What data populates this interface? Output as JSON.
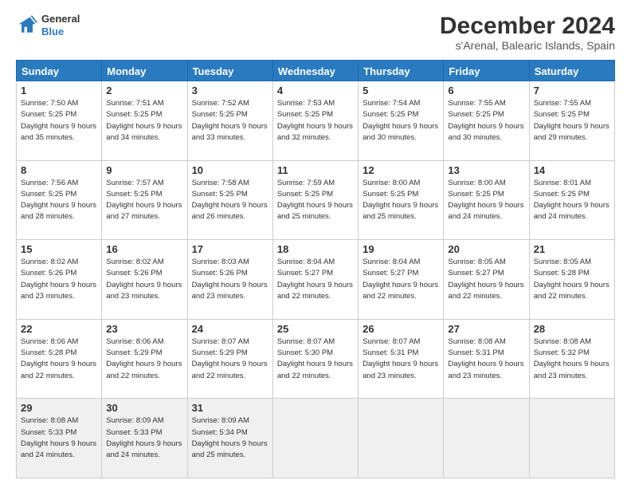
{
  "header": {
    "logo_line1": "General",
    "logo_line2": "Blue",
    "title": "December 2024",
    "subtitle": "s'Arenal, Balearic Islands, Spain"
  },
  "days_of_week": [
    "Sunday",
    "Monday",
    "Tuesday",
    "Wednesday",
    "Thursday",
    "Friday",
    "Saturday"
  ],
  "weeks": [
    [
      {
        "day": 1,
        "sunrise": "7:50 AM",
        "sunset": "5:25 PM",
        "daylight": "9 hours and 35 minutes."
      },
      {
        "day": 2,
        "sunrise": "7:51 AM",
        "sunset": "5:25 PM",
        "daylight": "9 hours and 34 minutes."
      },
      {
        "day": 3,
        "sunrise": "7:52 AM",
        "sunset": "5:25 PM",
        "daylight": "9 hours and 33 minutes."
      },
      {
        "day": 4,
        "sunrise": "7:53 AM",
        "sunset": "5:25 PM",
        "daylight": "9 hours and 32 minutes."
      },
      {
        "day": 5,
        "sunrise": "7:54 AM",
        "sunset": "5:25 PM",
        "daylight": "9 hours and 30 minutes."
      },
      {
        "day": 6,
        "sunrise": "7:55 AM",
        "sunset": "5:25 PM",
        "daylight": "9 hours and 30 minutes."
      },
      {
        "day": 7,
        "sunrise": "7:55 AM",
        "sunset": "5:25 PM",
        "daylight": "9 hours and 29 minutes."
      }
    ],
    [
      {
        "day": 8,
        "sunrise": "7:56 AM",
        "sunset": "5:25 PM",
        "daylight": "9 hours and 28 minutes."
      },
      {
        "day": 9,
        "sunrise": "7:57 AM",
        "sunset": "5:25 PM",
        "daylight": "9 hours and 27 minutes."
      },
      {
        "day": 10,
        "sunrise": "7:58 AM",
        "sunset": "5:25 PM",
        "daylight": "9 hours and 26 minutes."
      },
      {
        "day": 11,
        "sunrise": "7:59 AM",
        "sunset": "5:25 PM",
        "daylight": "9 hours and 25 minutes."
      },
      {
        "day": 12,
        "sunrise": "8:00 AM",
        "sunset": "5:25 PM",
        "daylight": "9 hours and 25 minutes."
      },
      {
        "day": 13,
        "sunrise": "8:00 AM",
        "sunset": "5:25 PM",
        "daylight": "9 hours and 24 minutes."
      },
      {
        "day": 14,
        "sunrise": "8:01 AM",
        "sunset": "5:25 PM",
        "daylight": "9 hours and 24 minutes."
      }
    ],
    [
      {
        "day": 15,
        "sunrise": "8:02 AM",
        "sunset": "5:26 PM",
        "daylight": "9 hours and 23 minutes."
      },
      {
        "day": 16,
        "sunrise": "8:02 AM",
        "sunset": "5:26 PM",
        "daylight": "9 hours and 23 minutes."
      },
      {
        "day": 17,
        "sunrise": "8:03 AM",
        "sunset": "5:26 PM",
        "daylight": "9 hours and 23 minutes."
      },
      {
        "day": 18,
        "sunrise": "8:04 AM",
        "sunset": "5:27 PM",
        "daylight": "9 hours and 22 minutes."
      },
      {
        "day": 19,
        "sunrise": "8:04 AM",
        "sunset": "5:27 PM",
        "daylight": "9 hours and 22 minutes."
      },
      {
        "day": 20,
        "sunrise": "8:05 AM",
        "sunset": "5:27 PM",
        "daylight": "9 hours and 22 minutes."
      },
      {
        "day": 21,
        "sunrise": "8:05 AM",
        "sunset": "5:28 PM",
        "daylight": "9 hours and 22 minutes."
      }
    ],
    [
      {
        "day": 22,
        "sunrise": "8:06 AM",
        "sunset": "5:28 PM",
        "daylight": "9 hours and 22 minutes."
      },
      {
        "day": 23,
        "sunrise": "8:06 AM",
        "sunset": "5:29 PM",
        "daylight": "9 hours and 22 minutes."
      },
      {
        "day": 24,
        "sunrise": "8:07 AM",
        "sunset": "5:29 PM",
        "daylight": "9 hours and 22 minutes."
      },
      {
        "day": 25,
        "sunrise": "8:07 AM",
        "sunset": "5:30 PM",
        "daylight": "9 hours and 22 minutes."
      },
      {
        "day": 26,
        "sunrise": "8:07 AM",
        "sunset": "5:31 PM",
        "daylight": "9 hours and 23 minutes."
      },
      {
        "day": 27,
        "sunrise": "8:08 AM",
        "sunset": "5:31 PM",
        "daylight": "9 hours and 23 minutes."
      },
      {
        "day": 28,
        "sunrise": "8:08 AM",
        "sunset": "5:32 PM",
        "daylight": "9 hours and 23 minutes."
      }
    ],
    [
      {
        "day": 29,
        "sunrise": "8:08 AM",
        "sunset": "5:33 PM",
        "daylight": "9 hours and 24 minutes."
      },
      {
        "day": 30,
        "sunrise": "8:09 AM",
        "sunset": "5:33 PM",
        "daylight": "9 hours and 24 minutes."
      },
      {
        "day": 31,
        "sunrise": "8:09 AM",
        "sunset": "5:34 PM",
        "daylight": "9 hours and 25 minutes."
      },
      null,
      null,
      null,
      null
    ]
  ]
}
